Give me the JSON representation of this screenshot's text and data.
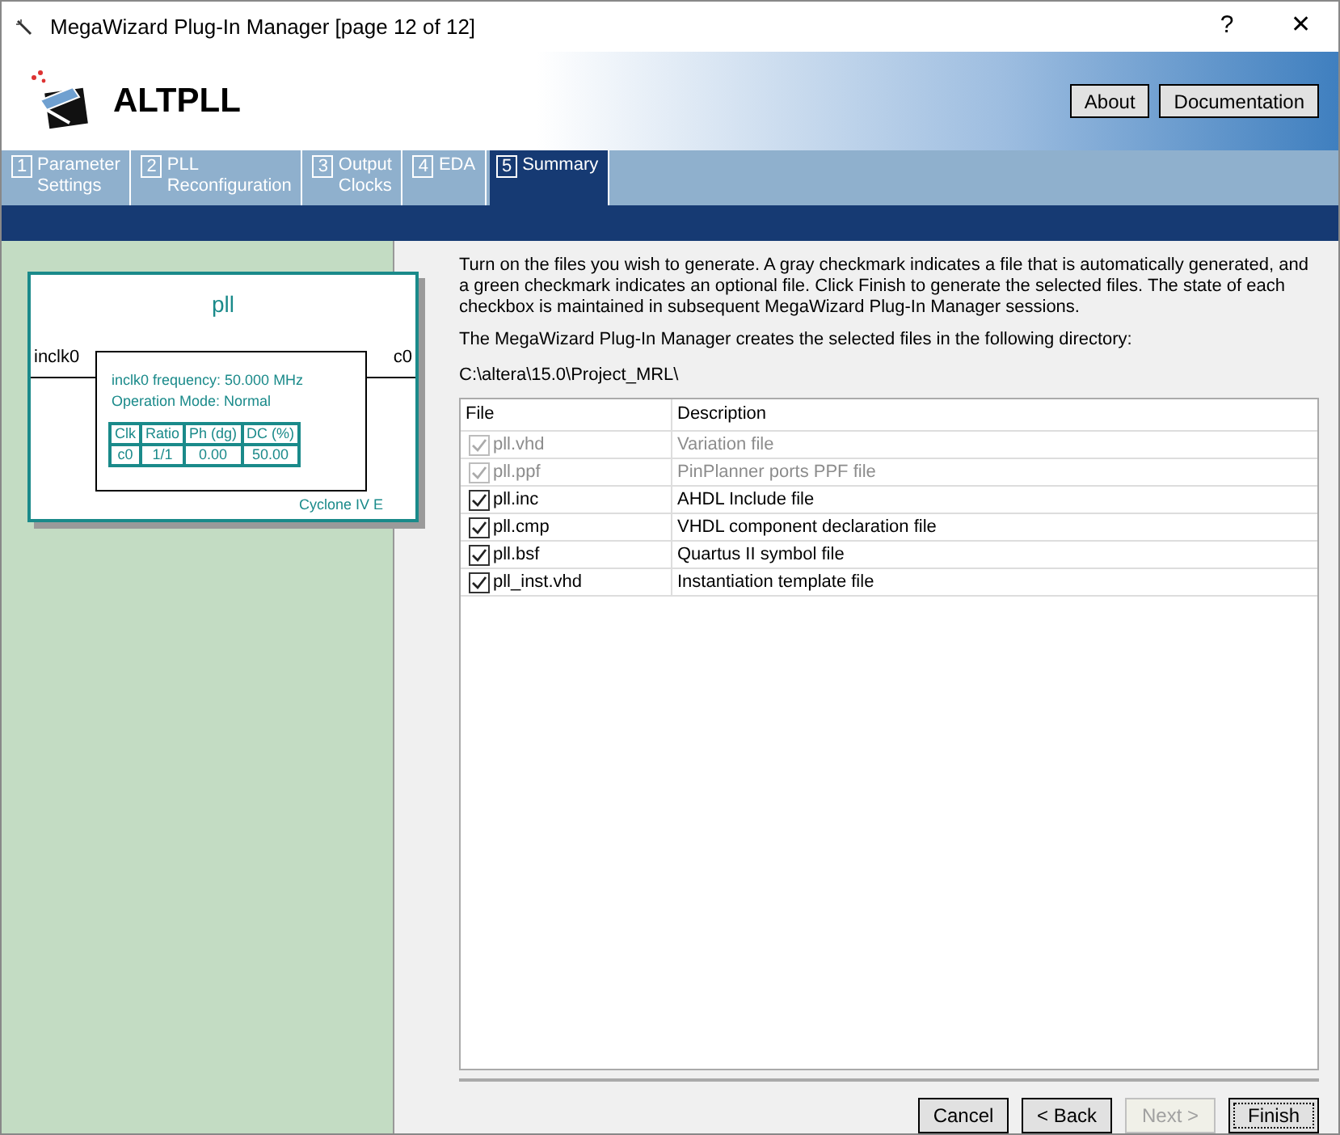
{
  "window": {
    "title": "MegaWizard Plug-In Manager [page 12 of 12]",
    "controls": [
      "?",
      "✕"
    ]
  },
  "header": {
    "title": "ALTPLL",
    "buttons": [
      "About",
      "Documentation"
    ]
  },
  "tabs": [
    {
      "number": "1",
      "label": "Parameter Settings",
      "selected": false
    },
    {
      "number": "2",
      "label": "PLL Reconfiguration",
      "selected": false
    },
    {
      "number": "3",
      "label": "Output Clocks",
      "selected": false
    },
    {
      "number": "4",
      "label": "EDA",
      "selected": false
    },
    {
      "number": "5",
      "label": "Summary",
      "selected": true
    }
  ],
  "diagram": {
    "title": "pll",
    "input": "inclk0",
    "output": "c0",
    "frequency": "inclk0 frequency: 50.000 MHz",
    "mode": "Operation Mode: Normal",
    "columns": [
      "Clk",
      "Ratio",
      "Ph (dg)",
      "DC (%)"
    ],
    "row": [
      "c0",
      "1/1",
      "0.00",
      "50.00"
    ],
    "device": "Cyclone IV E"
  },
  "intro": "Turn on the files you wish to generate. A gray checkmark indicates a file that is automatically generated, and a green checkmark indicates an optional file. Click Finish to generate the selected files. The state of each checkbox is maintained in subsequent MegaWizard Plug-In Manager sessions.",
  "directory_label": "The MegaWizard Plug-In Manager creates the selected files in the following directory:",
  "directory": "C:\\altera\\15.0\\Project_MRL\\",
  "table": {
    "columns": [
      "File",
      "Description"
    ],
    "rows": [
      {
        "file": "pll.vhd",
        "description": "Variation file",
        "checked": true,
        "disabled": true
      },
      {
        "file": "pll.ppf",
        "description": "PinPlanner ports PPF file",
        "checked": true,
        "disabled": true
      },
      {
        "file": "pll.inc",
        "description": "AHDL Include file",
        "checked": true,
        "disabled": false
      },
      {
        "file": "pll.cmp",
        "description": "VHDL component declaration file",
        "checked": true,
        "disabled": false
      },
      {
        "file": "pll.bsf",
        "description": "Quartus II symbol file",
        "checked": true,
        "disabled": false
      },
      {
        "file": "pll_inst.vhd",
        "description": "Instantiation template file",
        "checked": true,
        "disabled": false
      }
    ]
  },
  "buttons": [
    {
      "label": "Cancel",
      "disabled": false,
      "focused": false
    },
    {
      "label": "< Back",
      "disabled": false,
      "focused": false
    },
    {
      "label": "Next >",
      "disabled": true,
      "focused": false
    },
    {
      "label": "Finish",
      "disabled": false,
      "focused": true
    }
  ]
}
